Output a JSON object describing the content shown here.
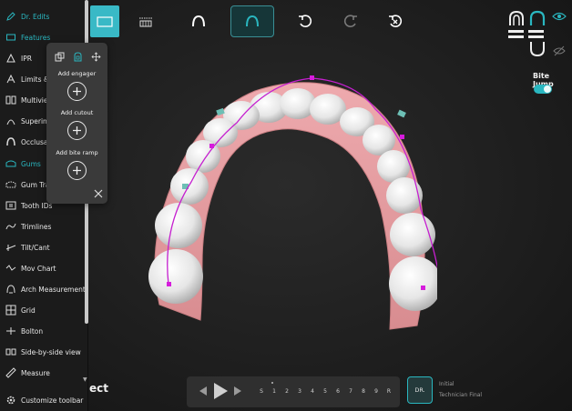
{
  "sidebar": {
    "items": [
      {
        "label": "Dr. Edits",
        "icon": "pencil-icon",
        "active": true
      },
      {
        "label": "Features",
        "icon": "features-icon",
        "active": true
      },
      {
        "label": "IPR",
        "icon": "ipr-icon",
        "active": false
      },
      {
        "label": "Limits &",
        "icon": "limits-icon",
        "active": false
      },
      {
        "label": "Multiview",
        "icon": "multiview-icon",
        "active": false
      },
      {
        "label": "Superimp",
        "icon": "superimpose-icon",
        "active": false
      },
      {
        "label": "Occlusal",
        "icon": "occlusal-icon",
        "active": false
      },
      {
        "label": "Gums",
        "icon": "gums-icon",
        "active": true
      },
      {
        "label": "Gum Tran",
        "icon": "gum-transparency-icon",
        "active": false
      },
      {
        "label": "Tooth IDs",
        "icon": "tooth-ids-icon",
        "active": false
      },
      {
        "label": "Trimlines",
        "icon": "trimlines-icon",
        "active": false
      },
      {
        "label": "Tilt/Cant",
        "icon": "tilt-icon",
        "active": false
      },
      {
        "label": "Mov Chart",
        "icon": "chart-icon",
        "active": false
      },
      {
        "label": "Arch Measurements",
        "icon": "arch-icon",
        "active": false
      },
      {
        "label": "Grid",
        "icon": "grid-icon",
        "active": false
      },
      {
        "label": "Bolton",
        "icon": "bolton-icon",
        "active": false
      },
      {
        "label": "Side-by-side view",
        "icon": "side-by-side-icon",
        "active": false
      },
      {
        "label": "Measure",
        "icon": "ruler-icon",
        "active": false
      },
      {
        "label": "Customize toolbar",
        "icon": "gear-icon",
        "active": false
      }
    ]
  },
  "popup": {
    "labels": {
      "engager": "Add engager",
      "cutout": "Add cutout",
      "bite_ramp": "Add bite ramp"
    }
  },
  "right_panel": {
    "bite_jump_label": "Bite Jump",
    "bite_jump_on": true
  },
  "timeline": {
    "stages": [
      "S",
      "1",
      "2",
      "3",
      "4",
      "5",
      "6",
      "7",
      "8",
      "9",
      "R"
    ],
    "dr_label": "DR.",
    "legend_initial": "Initial",
    "legend_final": "Technician Final"
  },
  "select_word": "ect",
  "colors": {
    "accent": "#2ab7c0",
    "arch_line": "#c51fcf",
    "gum": "#e3a0a3"
  }
}
